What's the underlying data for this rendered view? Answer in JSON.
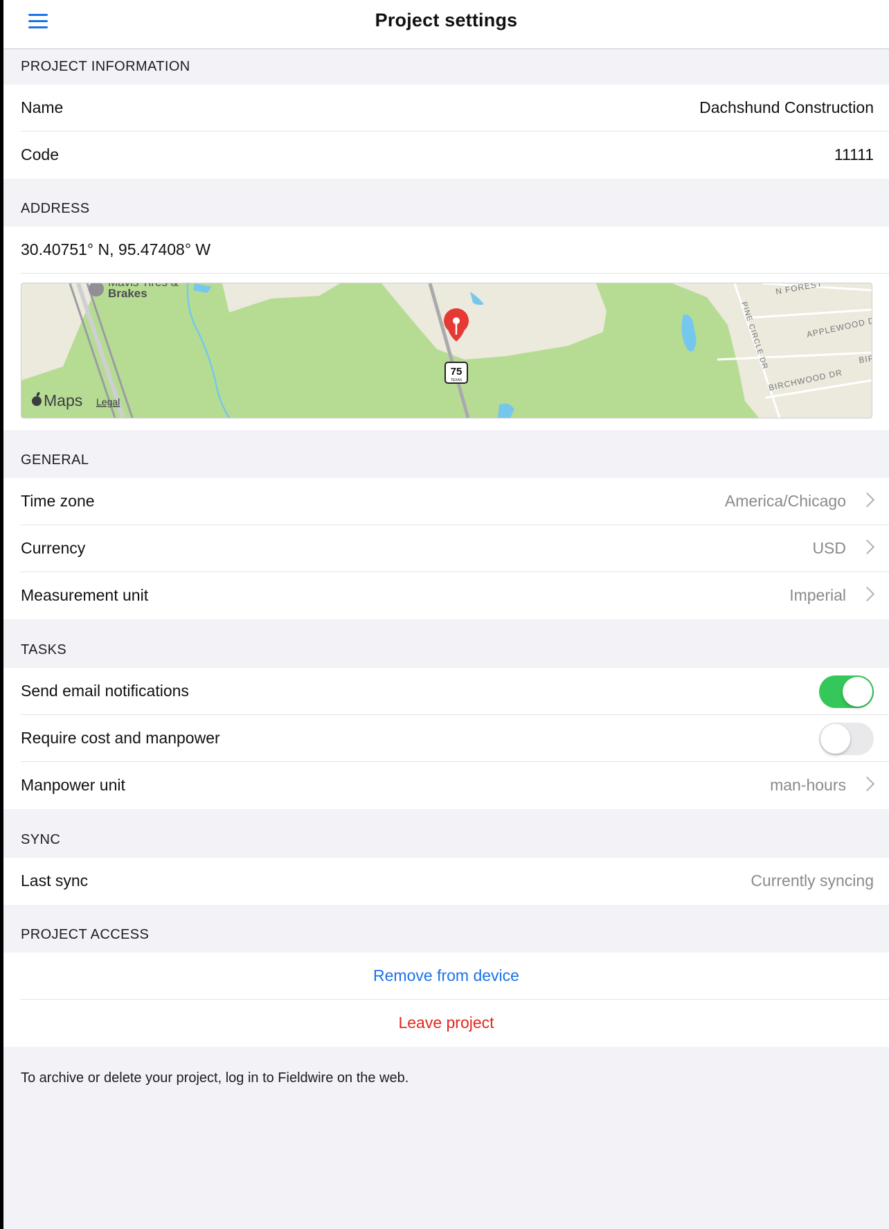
{
  "nav": {
    "title": "Project settings",
    "menu_icon": "hamburger-menu-icon"
  },
  "sections": {
    "project_information": "PROJECT INFORMATION",
    "address": "ADDRESS",
    "general": "GENERAL",
    "tasks": "TASKS",
    "sync": "SYNC",
    "project_access": "PROJECT ACCESS"
  },
  "project": {
    "name_label": "Name",
    "name_value": "Dachshund Construction",
    "code_label": "Code",
    "code_value": "11111"
  },
  "address": {
    "coordinates": "30.40751° N, 95.47408° W",
    "map": {
      "poi_label_1": "Mavis Tires &",
      "poi_label_2": "Brakes",
      "road_1": "N FOREST",
      "road_2": "PINE CIRCLE DR",
      "road_3": "APPLEWOOD D",
      "road_4": "BIRCHWOOD DR",
      "road_5": "BIR",
      "highway_number": "75",
      "highway_state": "TEXAS",
      "brand": "Maps",
      "legal": "Legal"
    }
  },
  "general": {
    "time_zone_label": "Time zone",
    "time_zone_value": "America/Chicago",
    "currency_label": "Currency",
    "currency_value": "USD",
    "measurement_label": "Measurement unit",
    "measurement_value": "Imperial"
  },
  "tasks": {
    "email_label": "Send email notifications",
    "email_enabled": true,
    "cost_label": "Require cost and manpower",
    "cost_enabled": false,
    "manpower_label": "Manpower unit",
    "manpower_value": "man-hours"
  },
  "sync": {
    "last_sync_label": "Last sync",
    "last_sync_value": "Currently syncing"
  },
  "access": {
    "remove_label": "Remove from device",
    "leave_label": "Leave project"
  },
  "footer": {
    "note": "To archive or delete your project, log in to Fieldwire on the web."
  },
  "colors": {
    "accent_blue": "#1a73e8",
    "destructive_red": "#e5251d",
    "toggle_on": "#34c759",
    "background": "#f2f2f7"
  }
}
